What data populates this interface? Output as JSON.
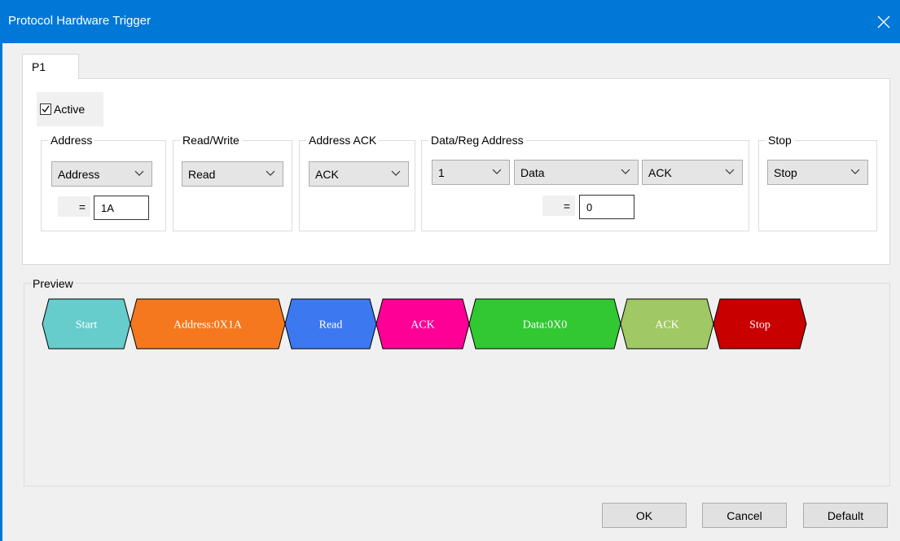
{
  "window": {
    "title": "Protocol Hardware Trigger"
  },
  "tabs": [
    {
      "label": "P1"
    }
  ],
  "active": {
    "label": "Active",
    "checked": true
  },
  "groups": {
    "address": {
      "title": "Address",
      "select_value": "Address",
      "eq": "=",
      "value": "1A"
    },
    "read_write": {
      "title": "Read/Write",
      "select_value": "Read"
    },
    "address_ack": {
      "title": "Address ACK",
      "select_value": "ACK"
    },
    "data_reg": {
      "title": "Data/Reg Address",
      "count_value": "1",
      "type_value": "Data",
      "ack_value": "ACK",
      "eq": "=",
      "value": "0"
    },
    "stop": {
      "title": "Stop",
      "select_value": "Stop"
    }
  },
  "preview": {
    "title": "Preview",
    "segments": [
      {
        "label": "Start",
        "color": "#66cccc"
      },
      {
        "label": "Address:0X1A",
        "color": "#f5781e"
      },
      {
        "label": "Read",
        "color": "#3c78f0"
      },
      {
        "label": "ACK",
        "color": "#ff0096"
      },
      {
        "label": "Data:0X0",
        "color": "#32c832"
      },
      {
        "label": "ACK",
        "color": "#a0c864"
      },
      {
        "label": "Stop",
        "color": "#c80000"
      }
    ]
  },
  "buttons": {
    "ok": "OK",
    "cancel": "Cancel",
    "default": "Default"
  },
  "icons": {
    "close": "close-icon",
    "chevron": "chevron-down-icon",
    "check": "checkmark-icon"
  }
}
